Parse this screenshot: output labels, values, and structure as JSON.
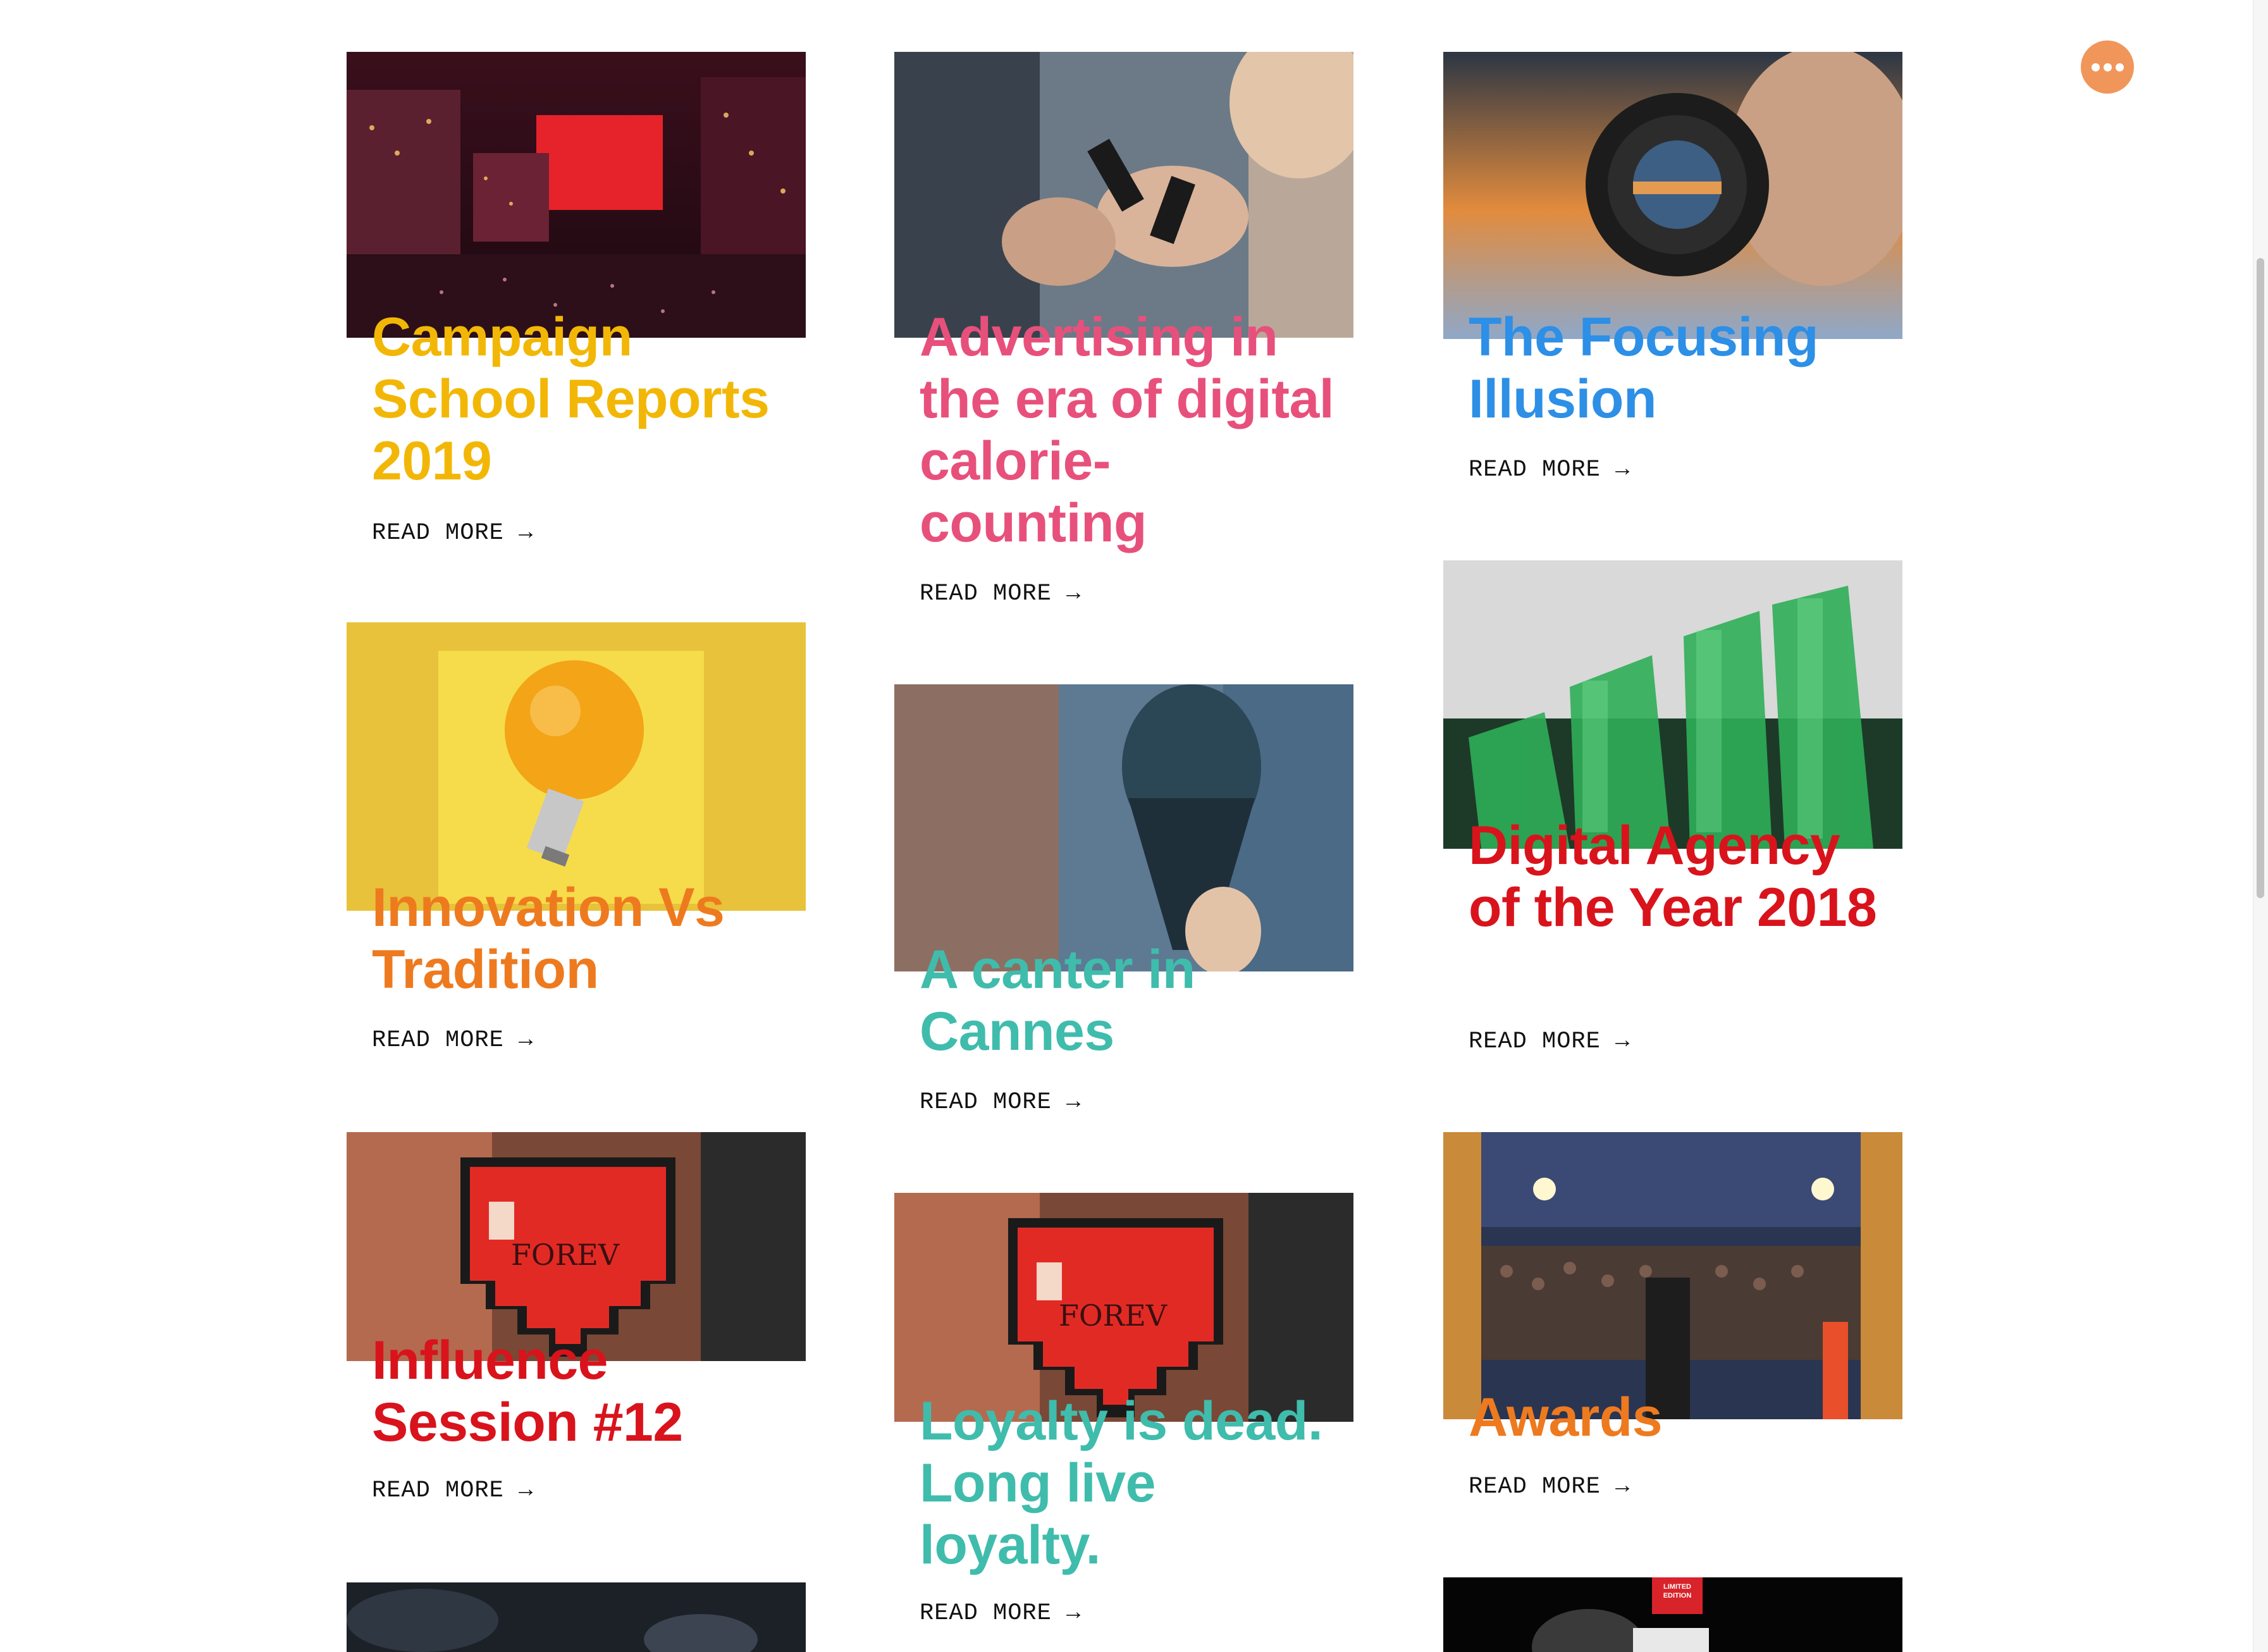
{
  "read_more_label": "READ MORE →",
  "menu_icon": "more-horizontal-icon",
  "cards": [
    {
      "title": "Campaign School Reports 2019",
      "color": "#f2b706",
      "read_more": "READ MORE →"
    },
    {
      "title": "Advertising in the era of digital calorie-counting",
      "color": "#e8507c",
      "read_more": "READ MORE →"
    },
    {
      "title": "The Focusing Illusion",
      "color": "#2d8fe6",
      "read_more": "READ MORE →"
    },
    {
      "title": "Innovation Vs Tradition",
      "color": "#ee7a1f",
      "read_more": "READ MORE →"
    },
    {
      "title": "A canter in Cannes",
      "color": "#3fbcac",
      "read_more": "READ MORE →"
    },
    {
      "title": "Digital Agency of the Year 2018",
      "color": "#d9131c",
      "read_more": "READ MORE →"
    },
    {
      "title": "Influence Session #12",
      "color": "#d9131c",
      "read_more": "READ MORE →"
    },
    {
      "title": "Loyalty is dead. Long live loyalty.",
      "color": "#3fbcac",
      "read_more": "READ MORE →"
    },
    {
      "title": "Awards",
      "color": "#ee7a1f",
      "read_more": "READ MORE →"
    }
  ],
  "partial_image_badge": {
    "text": "LIMITED EDITION"
  }
}
